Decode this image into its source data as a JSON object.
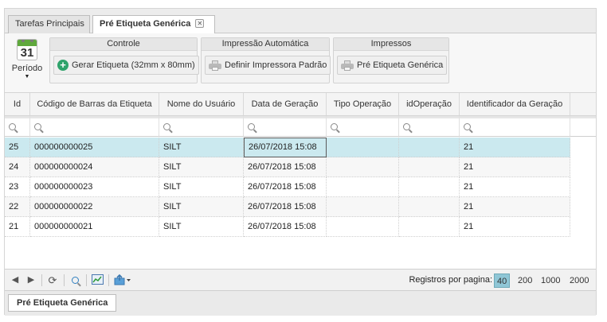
{
  "tabs": [
    {
      "label": "Tarefas Principais",
      "active": false
    },
    {
      "label": "Pré Etiqueta Genérica",
      "active": true
    }
  ],
  "toolbar": {
    "periodo": {
      "day": "31",
      "label": "Período"
    },
    "groups": [
      {
        "title": "Controle",
        "button": "Gerar Etiqueta (32mm x 80mm)",
        "icon": "plus-circle-icon"
      },
      {
        "title": "Impressão Automática",
        "button": "Definir Impressora Padrão",
        "icon": "printer-icon"
      },
      {
        "title": "Impressos",
        "button": "Pré Etiqueta Genérica",
        "icon": "printer-icon"
      }
    ]
  },
  "grid": {
    "columns": [
      "Id",
      "Código de Barras da Etiqueta",
      "Nome do Usuário",
      "Data de Geração",
      "Tipo Operação",
      "idOperação",
      "Identificador da Geração"
    ],
    "rows": [
      {
        "id": "25",
        "codigo": "000000000025",
        "usuario": "SILT",
        "data": "26/07/2018 15:08",
        "tipo": "",
        "idop": "",
        "ident": "21"
      },
      {
        "id": "24",
        "codigo": "000000000024",
        "usuario": "SILT",
        "data": "26/07/2018 15:08",
        "tipo": "",
        "idop": "",
        "ident": "21"
      },
      {
        "id": "23",
        "codigo": "000000000023",
        "usuario": "SILT",
        "data": "26/07/2018 15:08",
        "tipo": "",
        "idop": "",
        "ident": "21"
      },
      {
        "id": "22",
        "codigo": "000000000022",
        "usuario": "SILT",
        "data": "26/07/2018 15:08",
        "tipo": "",
        "idop": "",
        "ident": "21"
      },
      {
        "id": "21",
        "codigo": "000000000021",
        "usuario": "SILT",
        "data": "26/07/2018 15:08",
        "tipo": "",
        "idop": "",
        "ident": "21"
      }
    ],
    "selected_row": 0
  },
  "pager": {
    "label": "Registros por pagina:",
    "sizes": [
      "40",
      "200",
      "1000",
      "2000"
    ],
    "active_size": "40"
  },
  "bottom_tab": {
    "label": "Pré Etiqueta Genérica"
  },
  "colors": {
    "selected_row": "#cbe9ef",
    "active_page_size": "#8fc6d6",
    "calendar_green": "#5fa83c",
    "add_icon_green": "#2fa36b"
  }
}
